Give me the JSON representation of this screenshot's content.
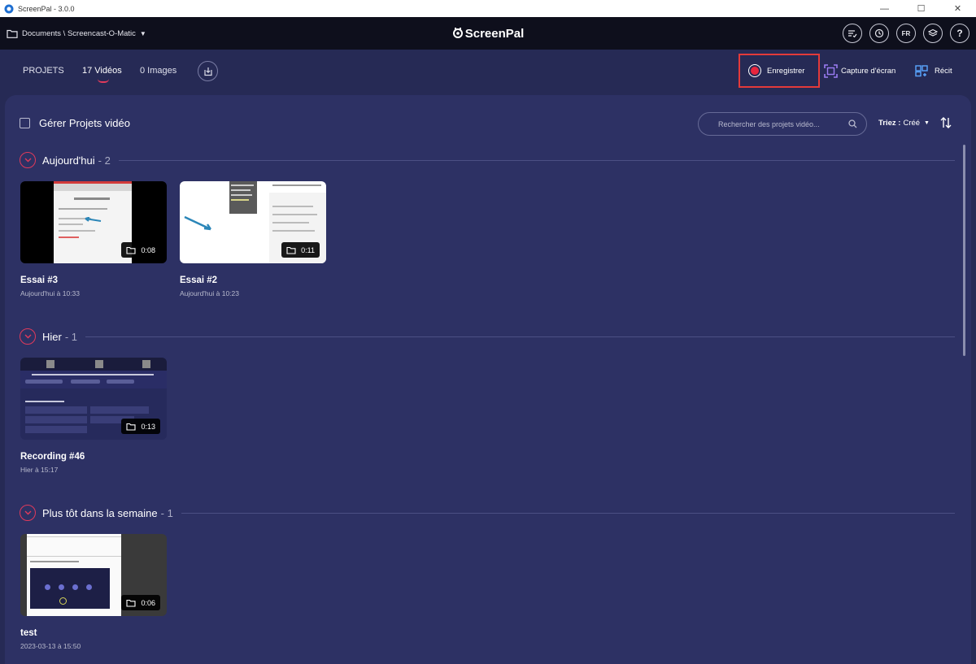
{
  "window": {
    "title": "ScreenPal - 3.0.0"
  },
  "topbar": {
    "path": "Documents \\ Screencast-O-Matic",
    "logo": "ScreenPal",
    "language": "FR"
  },
  "nav": {
    "tabs": [
      {
        "label": "PROJETS"
      },
      {
        "label": "17 Vidéos"
      },
      {
        "label": "0 Images"
      }
    ],
    "record_label": "Enregistrer",
    "capture_label": "Capture d'écran",
    "story_label": "Récit"
  },
  "toolbar": {
    "manage_label": "Gérer Projets vidéo",
    "search_placeholder": "Rechercher des projets vidéo...",
    "sort_label": "Triez :",
    "sort_value": "Créé"
  },
  "sections": [
    {
      "title": "Aujourd'hui",
      "count": "- 2",
      "items": [
        {
          "title": "Essai #3",
          "date": "Aujourd'hui à 10:33",
          "duration": "0:08"
        },
        {
          "title": "Essai  #2",
          "date": "Aujourd'hui à 10:23",
          "duration": "0:11"
        }
      ]
    },
    {
      "title": "Hier",
      "count": "- 1",
      "items": [
        {
          "title": "Recording #46",
          "date": "Hier à 15:17",
          "duration": "0:13"
        }
      ]
    },
    {
      "title": "Plus tôt dans la semaine",
      "count": "- 1",
      "items": [
        {
          "title": "test",
          "date": "2023-03-13 à 15:50",
          "duration": "0:06"
        }
      ]
    }
  ],
  "colors": {
    "background": "#262a55",
    "panel": "#2d3164",
    "topbar": "#0e0f1c",
    "accent": "#e03a5b",
    "record_red": "#e8263d"
  }
}
